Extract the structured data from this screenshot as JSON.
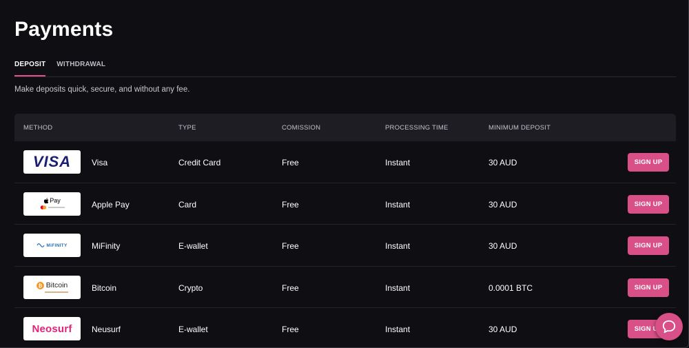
{
  "page": {
    "title": "Payments"
  },
  "tabs": [
    {
      "label": "DEPOSIT",
      "active": true
    },
    {
      "label": "WITHDRAWAL",
      "active": false
    }
  ],
  "subtitle": "Make deposits quick, secure, and without any fee.",
  "table": {
    "headers": {
      "method": "METHOD",
      "type": "TYPE",
      "commission": "COMISSION",
      "processing_time": "PROCESSING TIME",
      "minimum_deposit": "MINIMUM DEPOSIT"
    },
    "rows": [
      {
        "logo": "visa-logo",
        "logo_text": "VISA",
        "name": "Visa",
        "type": "Credit Card",
        "commission": "Free",
        "processing_time": "Instant",
        "minimum_deposit": "30 AUD",
        "action": "SIGN UP"
      },
      {
        "logo": "apple-pay-logo",
        "logo_text": "Pay",
        "name": "Apple Pay",
        "type": "Card",
        "commission": "Free",
        "processing_time": "Instant",
        "minimum_deposit": "30 AUD",
        "action": "SIGN UP"
      },
      {
        "logo": "mifinity-logo",
        "logo_text": "MiFINITY",
        "name": "MiFinity",
        "type": "E-wallet",
        "commission": "Free",
        "processing_time": "Instant",
        "minimum_deposit": "30 AUD",
        "action": "SIGN UP"
      },
      {
        "logo": "bitcoin-logo",
        "logo_text": "Bitcoin",
        "name": "Bitcoin",
        "type": "Crypto",
        "commission": "Free",
        "processing_time": "Instant",
        "minimum_deposit": "0.0001 BTC",
        "action": "SIGN UP"
      },
      {
        "logo": "neosurf-logo",
        "logo_text": "Neosurf",
        "name": "Neusurf",
        "type": "E-wallet",
        "commission": "Free",
        "processing_time": "Instant",
        "minimum_deposit": "30 AUD",
        "action": "SIGN UP"
      }
    ]
  },
  "colors": {
    "background": "#0f0e12",
    "header_bg": "#1e1d24",
    "accent": "#d94f88"
  },
  "chat_widget": {
    "icon": "chat-bubble-icon"
  }
}
